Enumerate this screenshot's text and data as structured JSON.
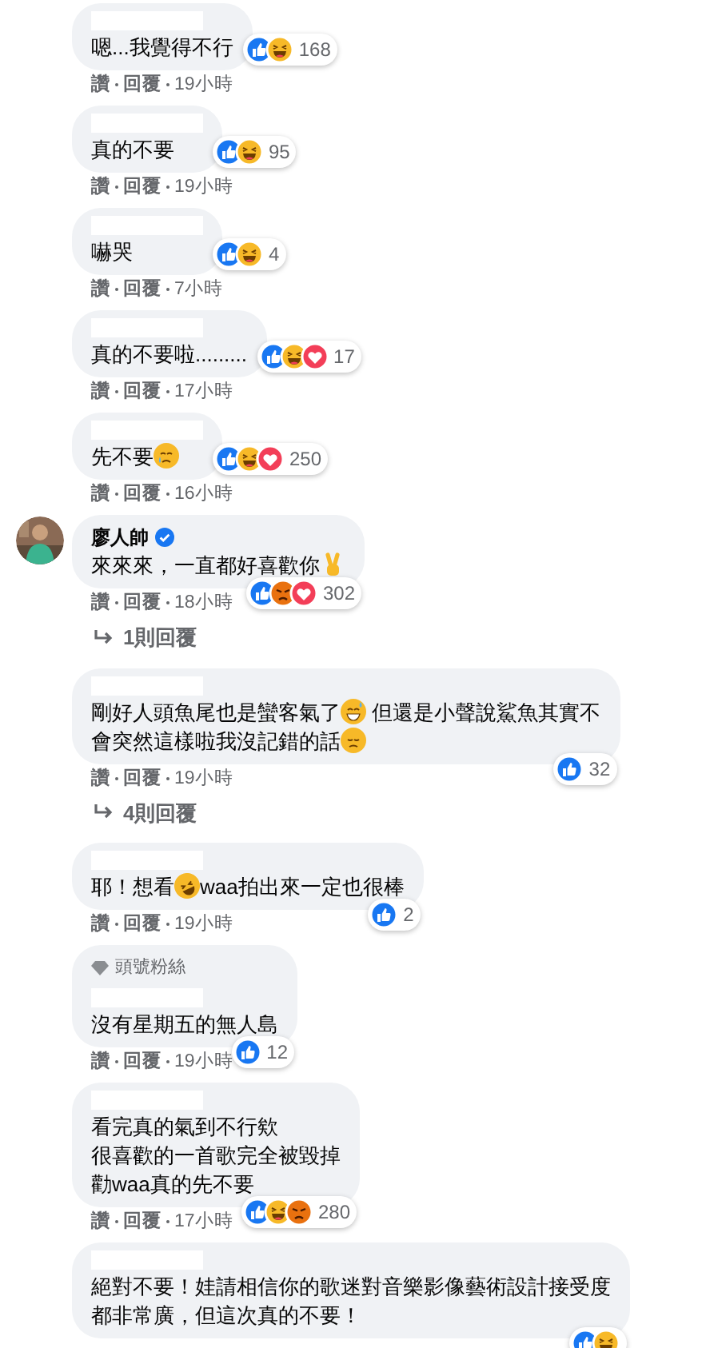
{
  "comments": [
    {
      "redacted": true,
      "segments": [
        {
          "kind": "text",
          "text": "嗯...我覺得不行"
        }
      ],
      "reactions": [
        {
          "kind": "like"
        },
        {
          "kind": "haha"
        }
      ],
      "count": "168",
      "actions": [
        "讚",
        "回覆"
      ],
      "time": "19小時"
    },
    {
      "redacted": true,
      "segments": [
        {
          "kind": "text",
          "text": "真的不要"
        }
      ],
      "reactions": [
        {
          "kind": "like"
        },
        {
          "kind": "haha"
        }
      ],
      "count": "95",
      "actions": [
        "讚",
        "回覆"
      ],
      "time": "19小時"
    },
    {
      "redacted": true,
      "segments": [
        {
          "kind": "text",
          "text": "嚇哭"
        }
      ],
      "reactions": [
        {
          "kind": "like"
        },
        {
          "kind": "haha"
        }
      ],
      "count": "4",
      "actions": [
        "讚",
        "回覆"
      ],
      "time": "7小時"
    },
    {
      "redacted": true,
      "segments": [
        {
          "kind": "text",
          "text": "真的不要啦........."
        }
      ],
      "reactions": [
        {
          "kind": "like"
        },
        {
          "kind": "haha"
        },
        {
          "kind": "love"
        }
      ],
      "count": "17",
      "actions": [
        "讚",
        "回覆"
      ],
      "time": "17小時"
    },
    {
      "redacted": true,
      "segments": [
        {
          "kind": "text",
          "text": "先不要"
        },
        {
          "kind": "cry"
        }
      ],
      "reactions": [
        {
          "kind": "like"
        },
        {
          "kind": "haha"
        },
        {
          "kind": "love"
        }
      ],
      "count": "250",
      "actions": [
        "讚",
        "回覆"
      ],
      "time": "16小時"
    },
    {
      "avatar": {
        "kind": "picture"
      },
      "author": "廖人帥",
      "verified": true,
      "segments": [
        {
          "kind": "text",
          "text": "來來來，一直都好喜歡你"
        },
        {
          "kind": "victory"
        }
      ],
      "reactions": [
        {
          "kind": "like"
        },
        {
          "kind": "angry"
        },
        {
          "kind": "love"
        }
      ],
      "count": "302",
      "actions": [
        "讚",
        "回覆"
      ],
      "time": "18小時",
      "replies": "1則回覆"
    },
    {
      "redacted": true,
      "segments": [
        {
          "kind": "text",
          "text": "剛好人頭魚尾也是蠻客氣了"
        },
        {
          "kind": "sweat"
        },
        {
          "kind": "text",
          "text": " 但還是小聲說鯊魚其實不"
        },
        {
          "kind": "break"
        },
        {
          "kind": "text",
          "text": "會突然這樣啦我沒記錯的話"
        },
        {
          "kind": "sad"
        }
      ],
      "reactions": [
        {
          "kind": "like"
        }
      ],
      "count": "32",
      "actions": [
        "讚",
        "回覆"
      ],
      "time": "19小時",
      "replies": "4則回覆"
    },
    {
      "redacted": true,
      "segments": [
        {
          "kind": "text",
          "text": "耶！想看"
        },
        {
          "kind": "rofl"
        },
        {
          "kind": "text",
          "text": "waa拍出來一定也很棒"
        }
      ],
      "reactions": [
        {
          "kind": "like"
        }
      ],
      "count": "2",
      "actions": [
        "讚",
        "回覆"
      ],
      "time": "19小時"
    },
    {
      "badge": "頭號粉絲",
      "redacted": true,
      "segments": [
        {
          "kind": "text",
          "text": "沒有星期五的無人島"
        }
      ],
      "reactions": [
        {
          "kind": "like"
        }
      ],
      "count": "12",
      "actions": [
        "讚",
        "回覆"
      ],
      "time": "19小時"
    },
    {
      "redacted": true,
      "segments": [
        {
          "kind": "text",
          "text": "看完真的氣到不行欸"
        },
        {
          "kind": "break"
        },
        {
          "kind": "text",
          "text": "很喜歡的一首歌完全被毀掉"
        },
        {
          "kind": "break"
        },
        {
          "kind": "text",
          "text": "勸waa真的先不要"
        }
      ],
      "reactions": [
        {
          "kind": "like"
        },
        {
          "kind": "haha"
        },
        {
          "kind": "angry"
        }
      ],
      "count": "280",
      "actions": [
        "讚",
        "回覆"
      ],
      "time": "17小時"
    },
    {
      "redacted": true,
      "segments": [
        {
          "kind": "text",
          "text": "絕對不要！娃請相信你的歌迷對音樂影像藝術設計接受度"
        },
        {
          "kind": "break"
        },
        {
          "kind": "text",
          "text": "都非常廣，但這次真的不要！"
        }
      ],
      "reactions": [
        {
          "kind": "like"
        },
        {
          "kind": "haha"
        }
      ]
    }
  ]
}
